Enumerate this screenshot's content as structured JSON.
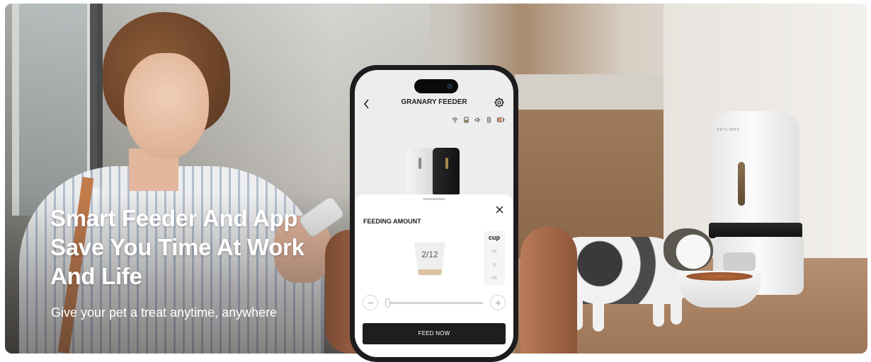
{
  "banner": {
    "headline": "Smart Feeder And App Save You Time At Work And Life",
    "subline": "Give your pet a treat anytime, anywhere"
  },
  "app": {
    "title": "GRANARY FEEDER",
    "sheet_title": "FEEDING AMOUNT",
    "amount_display": "2/12",
    "units": [
      "cup",
      "oz",
      "g",
      "ml"
    ],
    "selected_unit": "cup",
    "feed_button_label": "FEED NOW",
    "slider_fraction": 0.02
  },
  "feeder": {
    "logo": "PETLIBRO"
  },
  "colors": {
    "accent_dark": "#1e1e1e",
    "text_white": "#ffffff"
  }
}
